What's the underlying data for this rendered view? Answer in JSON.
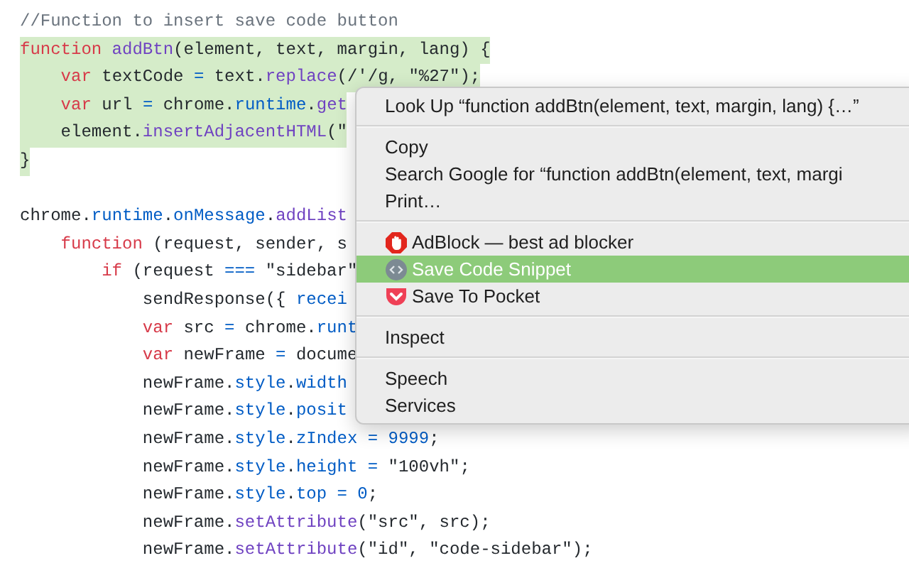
{
  "code_blocks": [
    {
      "lines": [
        {
          "selected": false,
          "tokens": [
            {
              "t": "//Function to insert save code button",
              "kind": "comment"
            }
          ]
        },
        {
          "selected": true,
          "tokens": [
            {
              "t": "function",
              "kind": "keyword"
            },
            {
              "t": " addBtn",
              "kind": "func"
            },
            {
              "t": "(element, text, margin, lang) {",
              "kind": "plain"
            }
          ]
        },
        {
          "selected": true,
          "tokens": [
            {
              "t": "    var",
              "kind": "keyword"
            },
            {
              "t": " textCode ",
              "kind": "plain"
            },
            {
              "t": "=",
              "kind": "prop"
            },
            {
              "t": " text.",
              "kind": "plain"
            },
            {
              "t": "replace",
              "kind": "func"
            },
            {
              "t": "(/'/g, \"%27\");",
              "kind": "plain"
            }
          ]
        },
        {
          "selected": true,
          "tokens": [
            {
              "t": "    var",
              "kind": "keyword"
            },
            {
              "t": " url ",
              "kind": "plain"
            },
            {
              "t": "=",
              "kind": "prop"
            },
            {
              "t": " chrome.",
              "kind": "plain"
            },
            {
              "t": "runtime",
              "kind": "prop"
            },
            {
              "t": ".",
              "kind": "plain"
            },
            {
              "t": "get",
              "kind": "func"
            }
          ]
        },
        {
          "selected": true,
          "tokens": [
            {
              "t": "    element.",
              "kind": "plain"
            },
            {
              "t": "insertAdjacentHTML",
              "kind": "func"
            },
            {
              "t": "(\"",
              "kind": "plain"
            }
          ]
        },
        {
          "selected": true,
          "tokens": [
            {
              "t": "}",
              "kind": "plain"
            }
          ]
        }
      ]
    },
    {
      "lines": [
        {
          "selected": false,
          "tokens": [
            {
              "t": "chrome.",
              "kind": "plain"
            },
            {
              "t": "runtime",
              "kind": "prop"
            },
            {
              "t": ".",
              "kind": "plain"
            },
            {
              "t": "onMessage",
              "kind": "prop"
            },
            {
              "t": ".",
              "kind": "plain"
            },
            {
              "t": "addList",
              "kind": "func"
            }
          ]
        },
        {
          "selected": false,
          "tokens": [
            {
              "t": "    function",
              "kind": "keyword"
            },
            {
              "t": " (request, sender, s",
              "kind": "plain"
            }
          ]
        },
        {
          "selected": false,
          "tokens": [
            {
              "t": "        if",
              "kind": "keyword"
            },
            {
              "t": " (request ",
              "kind": "plain"
            },
            {
              "t": "===",
              "kind": "prop"
            },
            {
              "t": " \"sidebar\"",
              "kind": "plain"
            }
          ]
        },
        {
          "selected": false,
          "tokens": [
            {
              "t": "            sendResponse({ ",
              "kind": "plain"
            },
            {
              "t": "recei",
              "kind": "prop"
            }
          ]
        },
        {
          "selected": false,
          "tokens": [
            {
              "t": "            var",
              "kind": "keyword"
            },
            {
              "t": " src ",
              "kind": "plain"
            },
            {
              "t": "=",
              "kind": "prop"
            },
            {
              "t": " chrome.",
              "kind": "plain"
            },
            {
              "t": "runt",
              "kind": "prop"
            }
          ]
        },
        {
          "selected": false,
          "tokens": [
            {
              "t": "            var",
              "kind": "keyword"
            },
            {
              "t": " newFrame ",
              "kind": "plain"
            },
            {
              "t": "=",
              "kind": "prop"
            },
            {
              "t": " docume",
              "kind": "plain"
            }
          ]
        },
        {
          "selected": false,
          "tokens": [
            {
              "t": "            newFrame.",
              "kind": "plain"
            },
            {
              "t": "style",
              "kind": "prop"
            },
            {
              "t": ".",
              "kind": "plain"
            },
            {
              "t": "width",
              "kind": "prop"
            }
          ]
        },
        {
          "selected": false,
          "tokens": [
            {
              "t": "            newFrame.",
              "kind": "plain"
            },
            {
              "t": "style",
              "kind": "prop"
            },
            {
              "t": ".",
              "kind": "plain"
            },
            {
              "t": "posit",
              "kind": "prop"
            }
          ]
        },
        {
          "selected": false,
          "tokens": [
            {
              "t": "            newFrame.",
              "kind": "plain"
            },
            {
              "t": "style",
              "kind": "prop"
            },
            {
              "t": ".",
              "kind": "plain"
            },
            {
              "t": "zIndex",
              "kind": "prop"
            },
            {
              "t": " =",
              "kind": "prop"
            },
            {
              "t": " 9999",
              "kind": "prop"
            },
            {
              "t": ";",
              "kind": "plain"
            }
          ]
        },
        {
          "selected": false,
          "tokens": [
            {
              "t": "            newFrame.",
              "kind": "plain"
            },
            {
              "t": "style",
              "kind": "prop"
            },
            {
              "t": ".",
              "kind": "plain"
            },
            {
              "t": "height",
              "kind": "prop"
            },
            {
              "t": " =",
              "kind": "prop"
            },
            {
              "t": " \"100vh\";",
              "kind": "plain"
            }
          ]
        },
        {
          "selected": false,
          "tokens": [
            {
              "t": "            newFrame.",
              "kind": "plain"
            },
            {
              "t": "style",
              "kind": "prop"
            },
            {
              "t": ".",
              "kind": "plain"
            },
            {
              "t": "top",
              "kind": "prop"
            },
            {
              "t": " =",
              "kind": "prop"
            },
            {
              "t": " 0",
              "kind": "prop"
            },
            {
              "t": ";",
              "kind": "plain"
            }
          ]
        },
        {
          "selected": false,
          "tokens": [
            {
              "t": "            newFrame.",
              "kind": "plain"
            },
            {
              "t": "setAttribute",
              "kind": "func"
            },
            {
              "t": "(\"src\", src);",
              "kind": "plain"
            }
          ]
        },
        {
          "selected": false,
          "tokens": [
            {
              "t": "            newFrame.",
              "kind": "plain"
            },
            {
              "t": "setAttribute",
              "kind": "func"
            },
            {
              "t": "(\"id\", \"code-sidebar\");",
              "kind": "plain"
            }
          ]
        }
      ]
    }
  ],
  "context_menu": [
    {
      "kind": "plain",
      "label": "Look Up “function addBtn(element, text, margin, lang) {…”",
      "selected": false
    },
    {
      "kind": "separator"
    },
    {
      "kind": "plain",
      "label": "Copy",
      "selected": false
    },
    {
      "kind": "plain",
      "label": "Search Google for “function addBtn(element, text, margi",
      "selected": false
    },
    {
      "kind": "plain",
      "label": "Print…",
      "selected": false
    },
    {
      "kind": "separator"
    },
    {
      "kind": "hand",
      "label": "AdBlock — best ad blocker",
      "selected": false
    },
    {
      "kind": "code",
      "label": "Save Code Snippet",
      "selected": true
    },
    {
      "kind": "pocket",
      "label": "Save To Pocket",
      "selected": false
    },
    {
      "kind": "separator"
    },
    {
      "kind": "plain",
      "label": "Inspect",
      "selected": false
    },
    {
      "kind": "separator"
    },
    {
      "kind": "plain",
      "label": "Speech",
      "selected": false
    },
    {
      "kind": "plain",
      "label": "Services",
      "selected": false
    }
  ]
}
